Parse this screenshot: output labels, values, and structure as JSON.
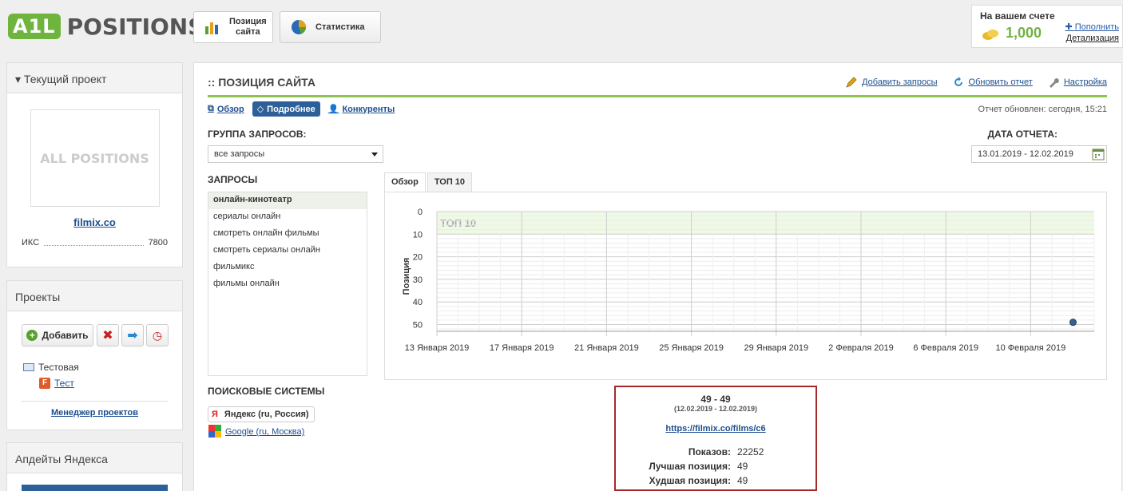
{
  "header": {
    "logo_badge": "A1L",
    "logo_text": "POSITIONS",
    "tabs": [
      {
        "label": "Позиция сайта"
      },
      {
        "label": "Статистика"
      }
    ],
    "balance": {
      "title": "На вашем счете",
      "amount": "1,000",
      "topup": "Пополнить",
      "details": "Детализация"
    }
  },
  "current_project": {
    "title": "Текущий проект",
    "logo_placeholder": "ALL POSITIONS",
    "site": "filmix.co",
    "iks_label": "ИКС",
    "iks_value": "7800"
  },
  "projects": {
    "title": "Проекты",
    "add_label": "Добавить",
    "tree": [
      {
        "label": "Тестовая"
      },
      {
        "label": "Тест"
      }
    ],
    "manager_link": "Менеджер проектов"
  },
  "yandex_updates": {
    "title": "Апдейты Яндекса"
  },
  "main": {
    "title": ":: ПОЗИЦИЯ САЙТА",
    "actions": {
      "add_queries": "Добавить запросы",
      "update_report": "Обновить отчет",
      "settings": "Настройка"
    },
    "subtabs": {
      "overview": "Обзор",
      "details": "Подробнее",
      "competitors": "Конкуренты"
    },
    "updated": "Отчет обновлен: сегодня, 15:21",
    "group_label": "ГРУППА ЗАПРОСОВ:",
    "group_value": "все запросы",
    "date_label": "ДАТА ОТЧЕТА:",
    "date_value": "13.01.2019 - 12.02.2019",
    "queries_label": "ЗАПРОСЫ",
    "queries": [
      "онлайн-кинотеатр",
      "сериалы онлайн",
      "смотреть онлайн фильмы",
      "смотреть сериалы онлайн",
      "фильмикс",
      "фильмы онлайн"
    ],
    "engines_label": "ПОИСКОВЫЕ СИСТЕМЫ",
    "engines": [
      {
        "label": "Яндекс (ru, Россия)"
      },
      {
        "label": "Google (ru, Москва)"
      }
    ],
    "chart_tabs": [
      "Обзор",
      "ТОП 10"
    ],
    "tooltip": {
      "range": "49  -  49",
      "dates": "(12.02.2019 - 12.02.2019)",
      "url": "https://filmix.co/films/c6",
      "shows_label": "Показов:",
      "shows_value": "22252",
      "best_label": "Лучшая позиция:",
      "best_value": "49",
      "worst_label": "Худшая позиция:",
      "worst_value": "49"
    }
  },
  "chart_data": {
    "type": "scatter",
    "ylabel": "Позиция",
    "band_label": "ТОП 10",
    "ylim": [
      0,
      50
    ],
    "y_reversed": true,
    "yticks": [
      0,
      10,
      20,
      30,
      40,
      50
    ],
    "x_ticks": [
      "13 Января 2019",
      "17 Января 2019",
      "21 Января 2019",
      "25 Января 2019",
      "29 Января 2019",
      "2 Февраля 2019",
      "6 Февраля 2019",
      "10 Февраля 2019"
    ],
    "xlim": [
      "2019-01-13",
      "2019-02-13"
    ],
    "points": [
      {
        "x": "2019-02-12",
        "y": 49
      }
    ],
    "colors": {
      "point": "#3a5f8f",
      "band": "#eefae4"
    }
  }
}
